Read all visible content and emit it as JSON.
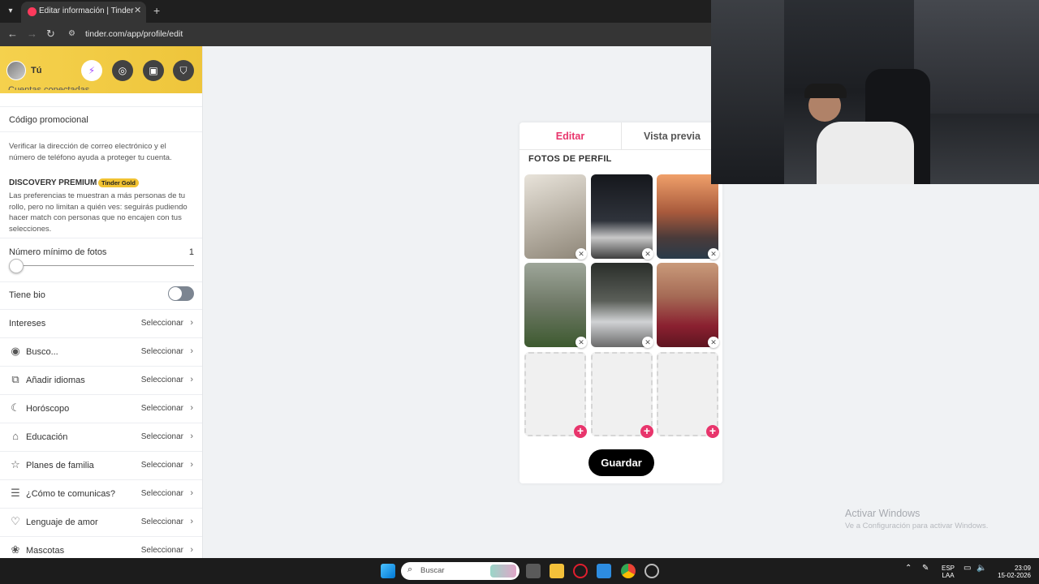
{
  "browser": {
    "tab_title": "Editar información | Tinder",
    "url": "tinder.com/app/profile/edit"
  },
  "sidebar": {
    "you_label": "Tú",
    "cut_label": "Cuentas conectadas",
    "promo_code": "Código promocional",
    "verify_text": "Verificar la dirección de correo electrónico y el número de teléfono ayuda a proteger tu cuenta.",
    "discovery_title": "DISCOVERY PREMIUM",
    "gold_badge": "Tinder Gold",
    "discovery_text": "Las preferencias te muestran a más personas de tu rollo, pero no limitan a quién ves: seguirás pudiendo hacer match con personas que no encajen con tus selecciones.",
    "min_photos_label": "Número mínimo de fotos",
    "min_photos_value": "1",
    "has_bio_label": "Tiene bio",
    "select_label": "Seleccionar",
    "items": [
      {
        "label": "Intereses",
        "icon": "none"
      },
      {
        "label": "Busco...",
        "icon": "eye-icon"
      },
      {
        "label": "Añadir idiomas",
        "icon": "language-icon"
      },
      {
        "label": "Horóscopo",
        "icon": "moon-icon"
      },
      {
        "label": "Educación",
        "icon": "graduation-cap-icon"
      },
      {
        "label": "Planes de familia",
        "icon": "baby-icon"
      },
      {
        "label": "¿Cómo te comunicas?",
        "icon": "chat-icon"
      },
      {
        "label": "Lenguaje de amor",
        "icon": "heart-chat-icon"
      },
      {
        "label": "Mascotas",
        "icon": "paw-icon"
      }
    ]
  },
  "editor": {
    "tab_edit": "Editar",
    "tab_preview": "Vista previa",
    "section_title": "FOTOS DE PERFIL",
    "save_label": "Guardar",
    "photos": [
      {
        "desc": "mirror selfie",
        "color": "#c9c4bd"
      },
      {
        "desc": "car at night",
        "color": "#2c2f36"
      },
      {
        "desc": "hot spring sunset",
        "color": "#b5704a"
      },
      {
        "desc": "football field",
        "color": "#6f7a6a"
      },
      {
        "desc": "white car",
        "color": "#4a4d4a"
      },
      {
        "desc": "selfie red shirt",
        "color": "#7a2a2f"
      }
    ],
    "empty_slots": 3
  },
  "watermark": {
    "title": "Activar Windows",
    "subtitle": "Ve a Configuración para activar Windows."
  },
  "taskbar": {
    "search_placeholder": "Buscar",
    "lang_top": "ESP",
    "lang_bottom": "LAA",
    "time": "23:09",
    "date": "15-02-2026"
  },
  "colors": {
    "accent": "#e8356c",
    "gold": "#f5d14d"
  }
}
